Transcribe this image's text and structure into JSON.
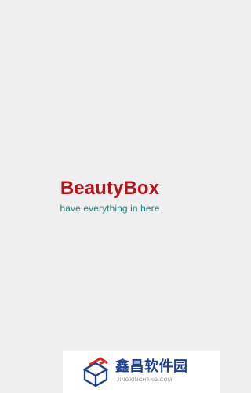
{
  "app": {
    "title": "BeautyBox",
    "tagline": "have everything in here"
  },
  "watermark": {
    "title": "鑫昌软件园",
    "domain": "JINGXINCHANG.COM"
  },
  "colors": {
    "background": "#efefef",
    "brand": "#b51219",
    "tagline": "#1f7c7b",
    "watermark_text": "#1f3d8f",
    "watermark_accent": "#d92b24",
    "watermark_domain": "#808080"
  },
  "icons": {
    "watermark_logo": "box-logo-icon"
  }
}
